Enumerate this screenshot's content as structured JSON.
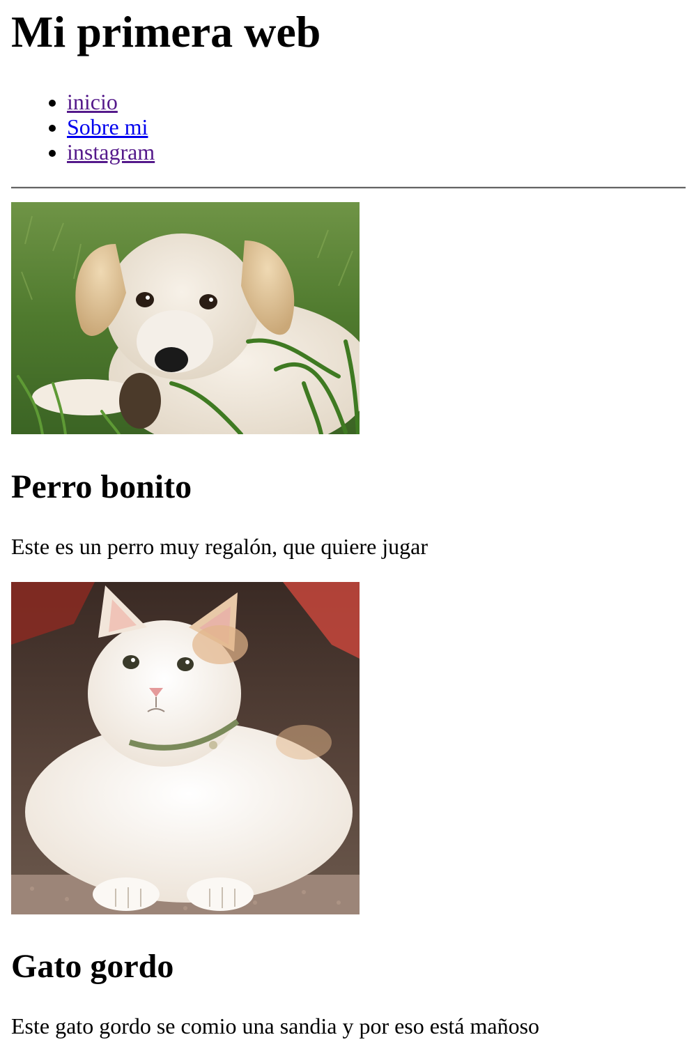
{
  "header": {
    "title": "Mi primera web"
  },
  "nav": {
    "items": [
      {
        "label": "inicio",
        "color": "#551a8b"
      },
      {
        "label": "Sobre mi",
        "color": "#0000ee"
      },
      {
        "label": "instagram",
        "color": "#551a8b"
      }
    ]
  },
  "cards": [
    {
      "image": "puppy-photo",
      "title": "Perro bonito",
      "text": "Este es un perro muy regalón, que quiere jugar"
    },
    {
      "image": "cat-photo",
      "title": "Gato gordo",
      "text": "Este gato gordo se comio una sandia y por eso está mañoso"
    }
  ],
  "colors": {
    "visited_link": "#551a8b",
    "unvisited_link": "#0000ee",
    "text": "#000000",
    "background": "#ffffff"
  }
}
